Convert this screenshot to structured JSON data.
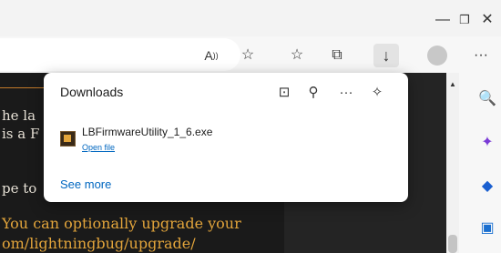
{
  "window": {
    "minimize_symbol": "—",
    "restore_symbol": "❐",
    "close_symbol": "✕"
  },
  "toolbar": {
    "read_aloud_symbol": "A",
    "favorite_add_symbol": "☆",
    "favorites_symbol": "☆",
    "collections_symbol": "⧉",
    "downloads_symbol": "↓",
    "more_symbol": "···"
  },
  "page": {
    "lines": [
      "he la",
      "is a F",
      "pe to"
    ],
    "orange_lines": [
      "You can optionally upgrade your",
      "om/lightningbug/upgrade/"
    ]
  },
  "downloads_panel": {
    "title": "Downloads",
    "open_folder_symbol": "⊡",
    "search_symbol": "⚲",
    "more_symbol": "···",
    "pin_symbol": "✧",
    "file_name": "LBFirmwareUtility_1_6.exe",
    "open_file_label": "Open file",
    "see_more_label": "See more"
  },
  "sidebar": {
    "search_symbol": "🔍",
    "copilot_symbol": "✦",
    "shopping_symbol": "◆",
    "tools_symbol": "▣"
  },
  "colors": {
    "accent": "#0067c0",
    "page_orange": "#e3a53b"
  }
}
